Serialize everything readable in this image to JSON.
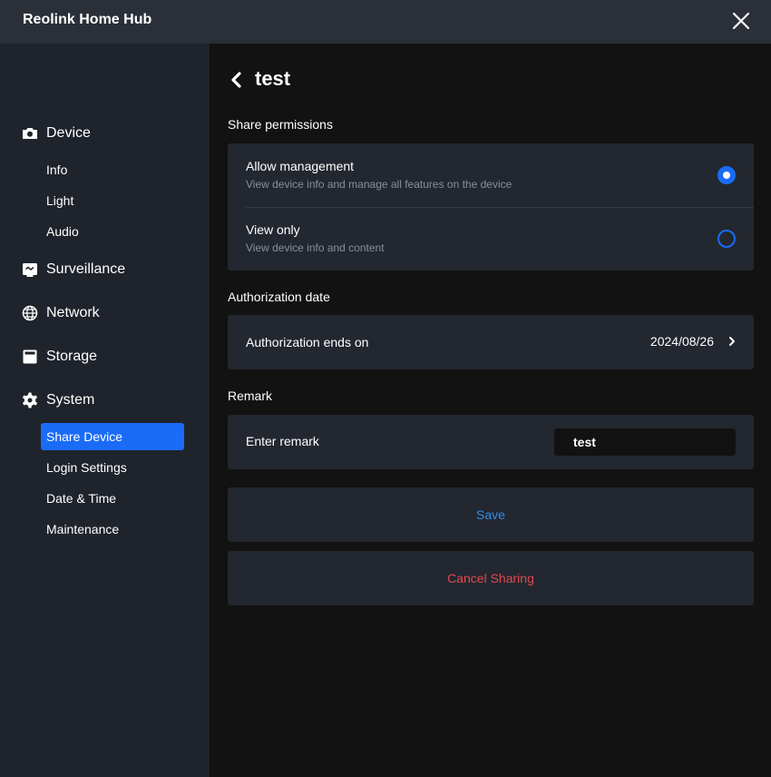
{
  "app": {
    "title": "Reolink Home Hub"
  },
  "sidebar": {
    "groups": [
      {
        "label": "Device",
        "icon": "camera-icon",
        "items": [
          {
            "label": "Info"
          },
          {
            "label": "Light"
          },
          {
            "label": "Audio"
          }
        ]
      },
      {
        "label": "Surveillance",
        "icon": "surveillance-icon"
      },
      {
        "label": "Network",
        "icon": "globe-icon"
      },
      {
        "label": "Storage",
        "icon": "storage-icon"
      },
      {
        "label": "System",
        "icon": "gear-icon",
        "items": [
          {
            "label": "Share Device",
            "active": true
          },
          {
            "label": "Login Settings"
          },
          {
            "label": "Date & Time"
          },
          {
            "label": "Maintenance"
          }
        ]
      }
    ]
  },
  "page": {
    "title": "test",
    "share_permissions": {
      "heading": "Share permissions",
      "options": [
        {
          "title": "Allow management",
          "description": "View device info and manage all features on the device",
          "selected": true
        },
        {
          "title": "View only",
          "description": "View device info and content",
          "selected": false
        }
      ]
    },
    "authorization": {
      "heading": "Authorization date",
      "label": "Authorization ends on",
      "value": "2024/08/26"
    },
    "remark": {
      "heading": "Remark",
      "label": "Enter remark",
      "value": "test"
    },
    "actions": {
      "save_label": "Save",
      "cancel_label": "Cancel Sharing"
    }
  },
  "colors": {
    "accent": "#1a6cf6",
    "save_text": "#2f8fe0",
    "danger_text": "#e04a4f",
    "titlebar_bg": "#2a2f38",
    "sidebar_bg": "#1f232b",
    "card_bg": "#232730",
    "main_bg": "#121212"
  }
}
